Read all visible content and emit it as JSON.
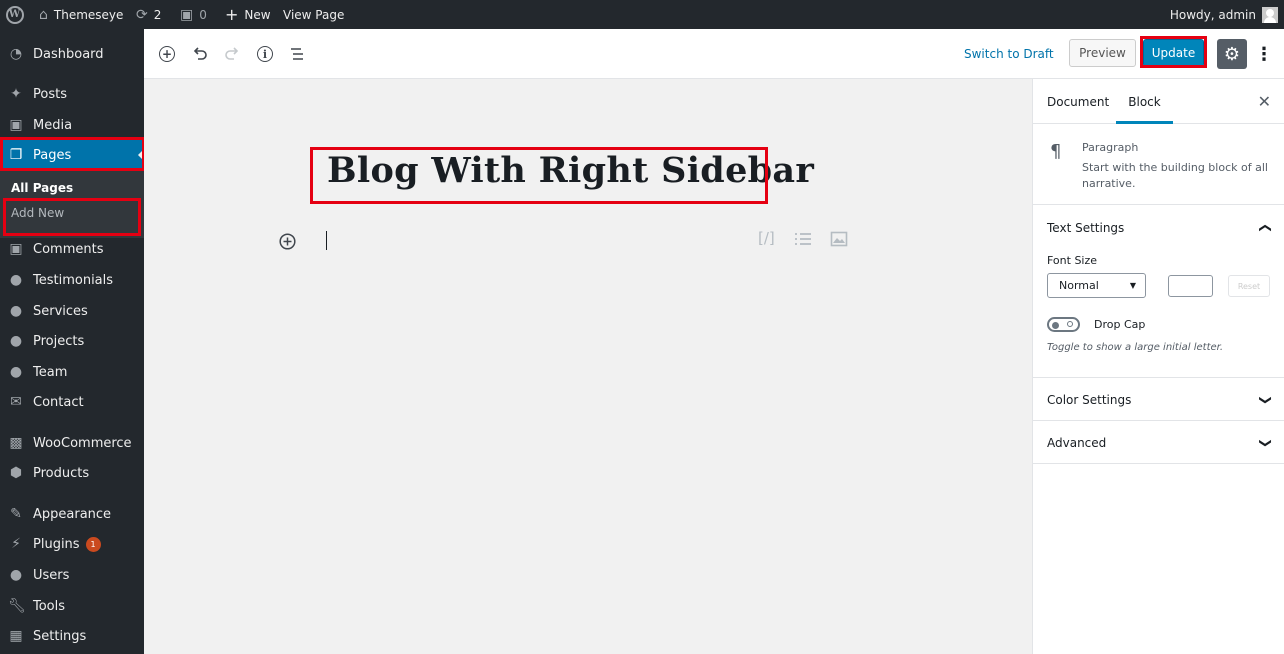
{
  "adminbar": {
    "site_name": "Themeseye",
    "updates_count": "2",
    "comments_count": "0",
    "new_label": "New",
    "view_label": "View Page",
    "howdy": "Howdy, admin"
  },
  "sidebar": {
    "items": [
      {
        "label": "Dashboard",
        "icon": "dashboard-icon"
      },
      {
        "label": "Posts",
        "icon": "pin-icon"
      },
      {
        "label": "Media",
        "icon": "media-icon"
      },
      {
        "label": "Pages",
        "icon": "pages-icon"
      },
      {
        "label": "Comments",
        "icon": "comment-icon"
      },
      {
        "label": "Testimonials",
        "icon": "users-icon"
      },
      {
        "label": "Services",
        "icon": "users-icon"
      },
      {
        "label": "Projects",
        "icon": "users-icon"
      },
      {
        "label": "Team",
        "icon": "users-icon"
      },
      {
        "label": "Contact",
        "icon": "envelope-icon"
      },
      {
        "label": "WooCommerce",
        "icon": "woo-icon"
      },
      {
        "label": "Products",
        "icon": "box-icon"
      },
      {
        "label": "Appearance",
        "icon": "brush-icon"
      },
      {
        "label": "Plugins",
        "icon": "plug-icon",
        "badge": "1"
      },
      {
        "label": "Users",
        "icon": "user-icon"
      },
      {
        "label": "Tools",
        "icon": "wrench-icon"
      },
      {
        "label": "Settings",
        "icon": "settings-icon"
      }
    ],
    "submenu": {
      "all_pages": "All Pages",
      "add_new": "Add New"
    }
  },
  "header": {
    "switch_to_draft": "Switch to Draft",
    "preview": "Preview",
    "update": "Update"
  },
  "editor": {
    "post_title": "Blog With Right Sidebar"
  },
  "panel": {
    "tab_document": "Document",
    "tab_block": "Block",
    "block_name": "Paragraph",
    "block_description": "Start with the building block of all narrative.",
    "text_settings": "Text Settings",
    "font_size_label": "Font Size",
    "font_size_value": "Normal",
    "reset_label": "Reset",
    "drop_cap_label": "Drop Cap",
    "drop_cap_help": "Toggle to show a large initial letter.",
    "color_settings": "Color Settings",
    "advanced": "Advanced"
  },
  "colors": {
    "admin_dark": "#23282d",
    "accent_blue": "#0073aa",
    "update_blue": "#0085ba",
    "highlight_red": "#e50012"
  }
}
